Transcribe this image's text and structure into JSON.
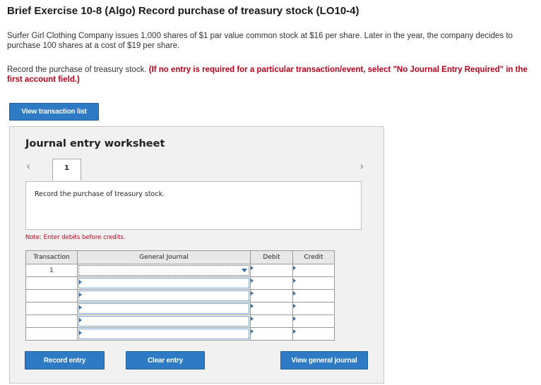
{
  "header": {
    "title": "Brief Exercise 10-8 (Algo) Record purchase of treasury stock (LO10-4)"
  },
  "problem": {
    "text": "Surfer Girl Clothing Company issues 1,000 shares of $1 par value common stock at $16 per share. Later in the year, the company decides to purchase 100 shares at a cost of $19 per share."
  },
  "instruction": {
    "text": "Record the purchase of treasury stock.",
    "note": "(If no entry is required for a particular transaction/event, select \"No Journal Entry Required\" in the first account field.)"
  },
  "buttons": {
    "view_transaction_list": "View transaction list",
    "record_entry": "Record entry",
    "clear_entry": "Clear entry",
    "view_general_journal": "View general journal"
  },
  "worksheet": {
    "title": "Journal entry worksheet",
    "current_tab": "1",
    "description": "Record the purchase of treasury stock.",
    "note": "Note: Enter debits before credits."
  },
  "journal": {
    "headers": {
      "transaction": "Transaction",
      "general_journal": "General Journal",
      "debit": "Debit",
      "credit": "Credit"
    },
    "rows": [
      {
        "transaction": "1",
        "account": "",
        "debit": "",
        "credit": ""
      },
      {
        "transaction": "",
        "account": "",
        "debit": "",
        "credit": ""
      },
      {
        "transaction": "",
        "account": "",
        "debit": "",
        "credit": ""
      },
      {
        "transaction": "",
        "account": "",
        "debit": "",
        "credit": ""
      },
      {
        "transaction": "",
        "account": "",
        "debit": "",
        "credit": ""
      },
      {
        "transaction": "",
        "account": "",
        "debit": "",
        "credit": ""
      }
    ]
  },
  "colors": {
    "button_blue": "#2f7ac4",
    "alert_red": "#c0001a",
    "panel_gray": "#f1f1f1"
  },
  "icons": {
    "prev": "chevron-left-icon",
    "next": "chevron-right-icon",
    "dropdown": "caret-down-icon"
  }
}
